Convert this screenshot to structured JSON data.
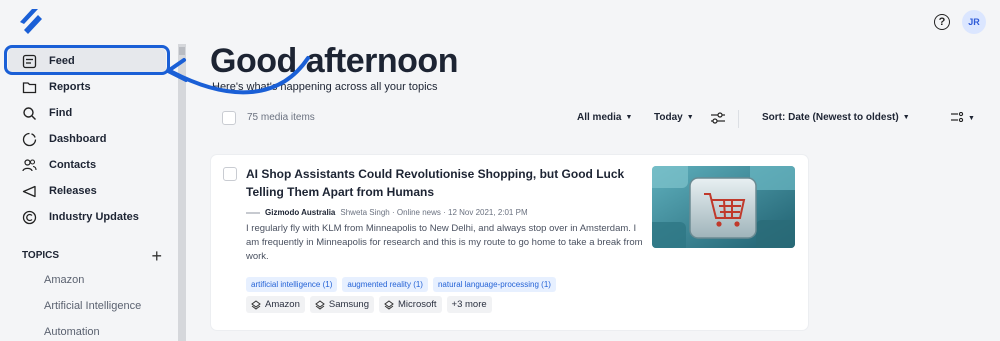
{
  "header": {
    "logo_icon": "brand-logo-icon",
    "help_icon": "help-icon",
    "help_glyph": "?",
    "avatar_initials": "JR"
  },
  "sidebar": {
    "items": [
      {
        "label": "Feed",
        "icon": "feed-icon",
        "active": true
      },
      {
        "label": "Reports",
        "icon": "folder-icon"
      },
      {
        "label": "Find",
        "icon": "search-icon"
      },
      {
        "label": "Dashboard",
        "icon": "dashboard-icon"
      },
      {
        "label": "Contacts",
        "icon": "contacts-icon"
      },
      {
        "label": "Releases",
        "icon": "megaphone-icon"
      },
      {
        "label": "Industry Updates",
        "icon": "industry-icon"
      }
    ],
    "topics_heading": "TOPICS",
    "add_topic": "+",
    "topics": [
      "Amazon",
      "Artificial Intelligence",
      "Automation"
    ]
  },
  "main": {
    "greeting": "Good afternoon",
    "subtitle": "Here's what's happening across all your topics",
    "toolbar": {
      "count": "75 media items",
      "media_filter": "All media",
      "date_filter": "Today",
      "filter_icon": "sliders-icon",
      "sort": "Sort: Date (Newest to oldest)",
      "view_icon": "view-options-icon"
    },
    "article": {
      "title": "AI Shop Assistants Could Revolutionise Shopping, but Good Luck Telling Them Apart from Humans",
      "source": "Gizmodo Australia",
      "meta": "Shweta Singh · Online news · 12 Nov 2021, 2:01 PM",
      "snippet": "I regularly fly with KLM from Minneapolis to New Delhi, and always stop over in Amsterdam. I am frequently in Minneapolis for research and this is my route to go home to take a break from work.",
      "tags": [
        "artificial intelligence (1)",
        "augmented reality (1)",
        "natural language-processing (1)"
      ],
      "entities": [
        "Amazon",
        "Samsung",
        "Microsoft"
      ],
      "more": "+3 more",
      "thumbnail": "shopping-cart-key-image"
    }
  },
  "colors": {
    "accent": "#1a5fd6",
    "tag_bg": "#e7f0ff",
    "tag_text": "#2563d6",
    "background": "#f4f5f7"
  }
}
